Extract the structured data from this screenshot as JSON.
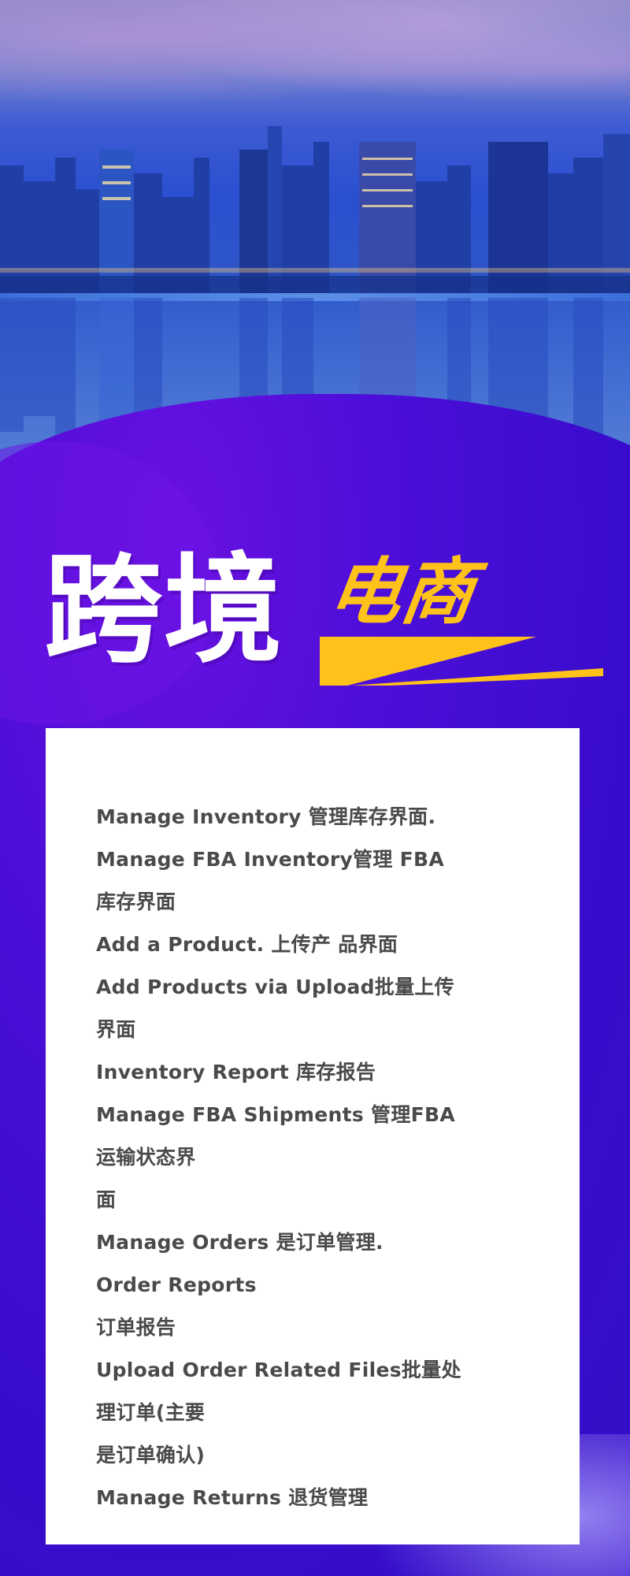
{
  "title": {
    "main": "跨境",
    "accent": "电商"
  },
  "colors": {
    "background_purple": "#3a0ccc",
    "accent_yellow": "#ffc21a",
    "card_white": "#ffffff",
    "text_gray": "#4a4a4a"
  },
  "content": {
    "lines": [
      "Manage Inventory 管理库存界面.",
      "Manage FBA Inventory管理 FBA",
      "库存界面",
      "Add a Product. 上传产 品界面",
      "Add Products via Upload批量上传",
      "界面",
      "Inventory Report 库存报告",
      "Manage FBA Shipments 管理FBA",
      "运输状态界",
      "面",
      "Manage Orders 是订单管理.",
      "Order Reports",
      "订单报告",
      "Upload Order Related Files批量处",
      "理订单(主要",
      "是订单确认)",
      "Manage Returns 退货管理"
    ]
  }
}
